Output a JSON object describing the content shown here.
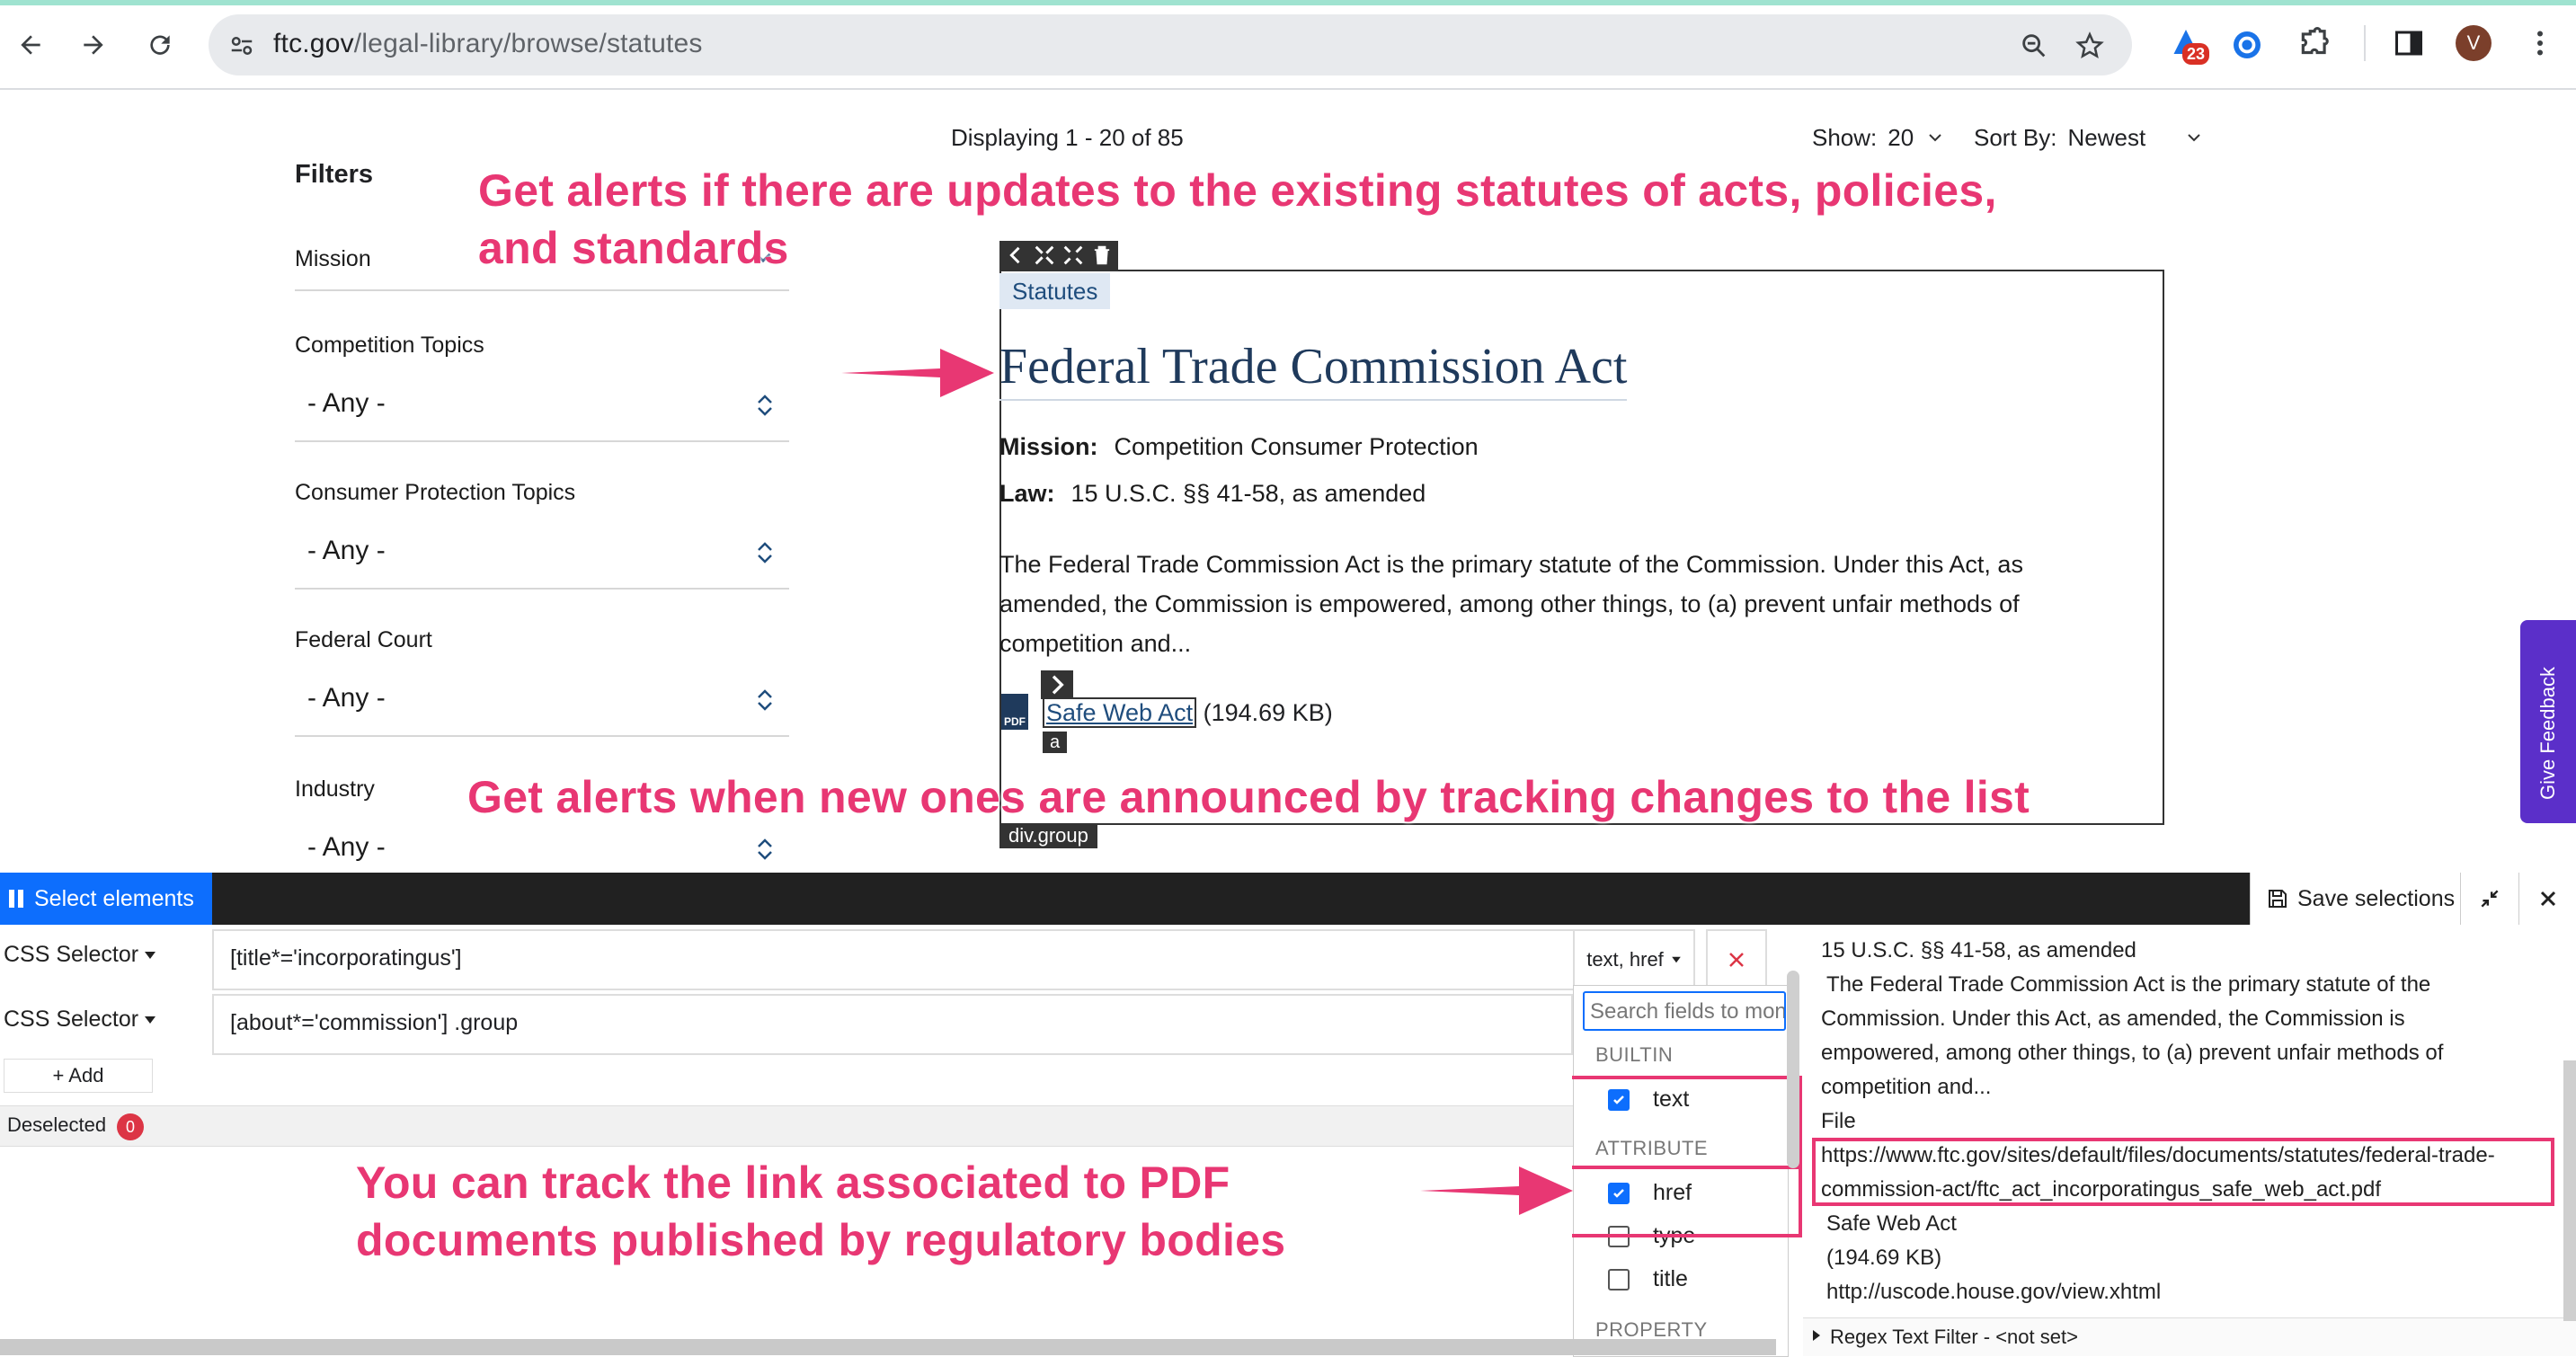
{
  "browser": {
    "url_host": "ftc.gov",
    "url_path": "/legal-library/browse/statutes",
    "extension_badge": "23",
    "profile_initial": "V"
  },
  "results": {
    "displaying": "Displaying 1 - 20 of 85",
    "show_label": "Show:",
    "show_value": "20",
    "sort_label": "Sort By:",
    "sort_value": "Newest"
  },
  "filters": {
    "title": "Filters",
    "mission_label": "Mission",
    "competition_label": "Competition Topics",
    "competition_value": "- Any -",
    "consumer_label": "Consumer Protection Topics",
    "consumer_value": "- Any -",
    "court_label": "Federal Court",
    "court_value": "- Any -",
    "industry_label": "Industry",
    "industry_value": "- Any -"
  },
  "result": {
    "tag": "Statutes",
    "title": "Federal Trade Commission Act",
    "mission_key": "Mission:",
    "mission_val": "Competition Consumer Protection",
    "law_key": "Law:",
    "law_val": "15 U.S.C. §§ 41-58, as amended",
    "desc": "The Federal Trade Commission Act is the primary statute of the Commission. Under this Act, as amended, the Commission is empowered, among other things, to (a) prevent unfair methods of competition and...",
    "pdf_icon": "PDF",
    "file_link": "Safe Web Act",
    "file_size": "(194.69 KB)",
    "tag_a": "a",
    "group_label": "div.group"
  },
  "annotations": {
    "top": "Get alerts if there are updates to the existing statutes of acts, policies, and standards",
    "mid": "Get alerts when new ones are announced by tracking changes to the list",
    "bottom": "You can track the link associated to PDF documents published by regulatory bodies"
  },
  "feedback": "Give Feedback",
  "extension": {
    "select_label": "Select elements",
    "save_label": "Save selections",
    "selector1_type": "CSS Selector",
    "selector1_value": "[title*='incorporatingus']",
    "selector1_fields": "text, href",
    "selector2_type": "CSS Selector",
    "selector2_value": "[about*='commission'] .group",
    "add_label": "+ Add",
    "deselected_label": "Deselected",
    "deselected_count": "0",
    "search_placeholder": "Search fields to monitor",
    "builtin_head": "BUILTIN",
    "attribute_head": "ATTRIBUTE",
    "property_head": "PROPERTY",
    "field_text": "text",
    "field_href": "href",
    "field_type": "type",
    "field_title": "title",
    "preview": {
      "law": "15 U.S.C. §§ 41-58, as amended",
      "desc1": "The Federal Trade Commission Act is the primary statute of the",
      "desc2": "Commission. Under this Act, as amended, the Commission is",
      "desc3": "empowered, among other things, to (a) prevent unfair methods of",
      "desc4": "competition and...",
      "file": "File",
      "href1": "https://www.ftc.gov/sites/default/files/documents/statutes/federal-trade-",
      "href2": "commission-act/ftc_act_incorporatingus_safe_web_act.pdf",
      "link": "Safe Web Act",
      "size": "(194.69 KB)",
      "uscode": "http://uscode.house.gov/view.xhtml",
      "regex": "Regex Text Filter - <not set>"
    }
  },
  "colors": {
    "annotation": "#e83773",
    "accent": "#0d6efd",
    "feedback_bg": "#5b2fc9"
  }
}
